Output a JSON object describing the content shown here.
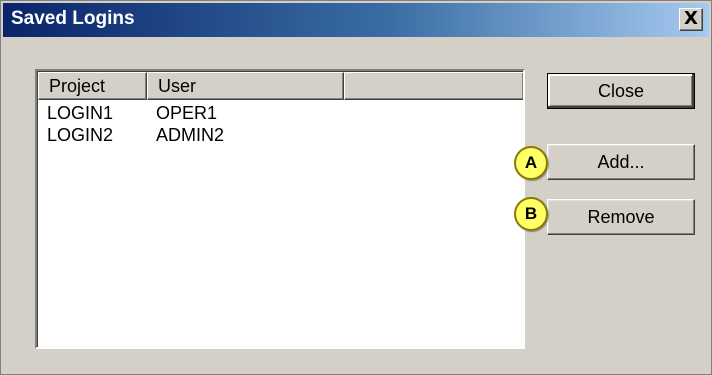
{
  "window": {
    "title": "Saved Logins",
    "close_glyph": "X"
  },
  "listview": {
    "columns": [
      "Project",
      "User",
      ""
    ],
    "rows": [
      {
        "project": "LOGIN1",
        "user": "OPER1"
      },
      {
        "project": "LOGIN2",
        "user": "ADMIN2"
      }
    ]
  },
  "buttons": {
    "close_label": "Close",
    "add_label": "Add...",
    "remove_label": "Remove"
  },
  "callouts": {
    "a": "A",
    "b": "B"
  },
  "colors": {
    "title_gradient_start": "#0a246a",
    "title_gradient_end": "#a6caf0",
    "window_face": "#d4d0c8",
    "callout_fill": "#ffff66"
  }
}
